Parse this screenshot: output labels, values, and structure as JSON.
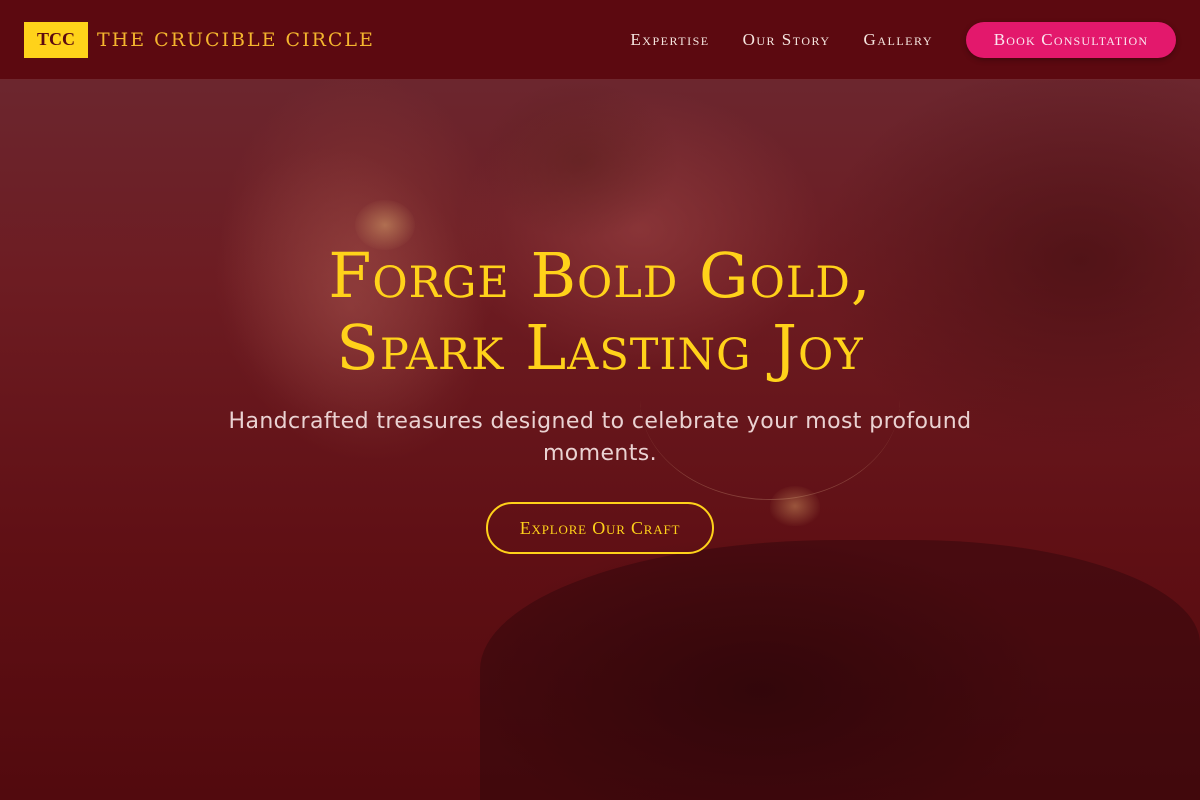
{
  "brand": {
    "mark": "TCC",
    "name": "THE CRUCIBLE CIRCLE"
  },
  "nav": {
    "links": [
      "Expertise",
      "Our Story",
      "Gallery"
    ],
    "cta": "Book Consultation"
  },
  "hero": {
    "title_line1": "Forge Bold Gold,",
    "title_line2": "Spark Lasting Joy",
    "subtitle": "Handcrafted treasures designed to celebrate your most profound moments.",
    "button": "Explore Our Craft",
    "background_image": "woman-wearing-gold-jewelry-photo"
  },
  "colors": {
    "primary_dark": "#5c0910",
    "gold": "#ffd21a",
    "accent_pink": "#e3186c"
  }
}
